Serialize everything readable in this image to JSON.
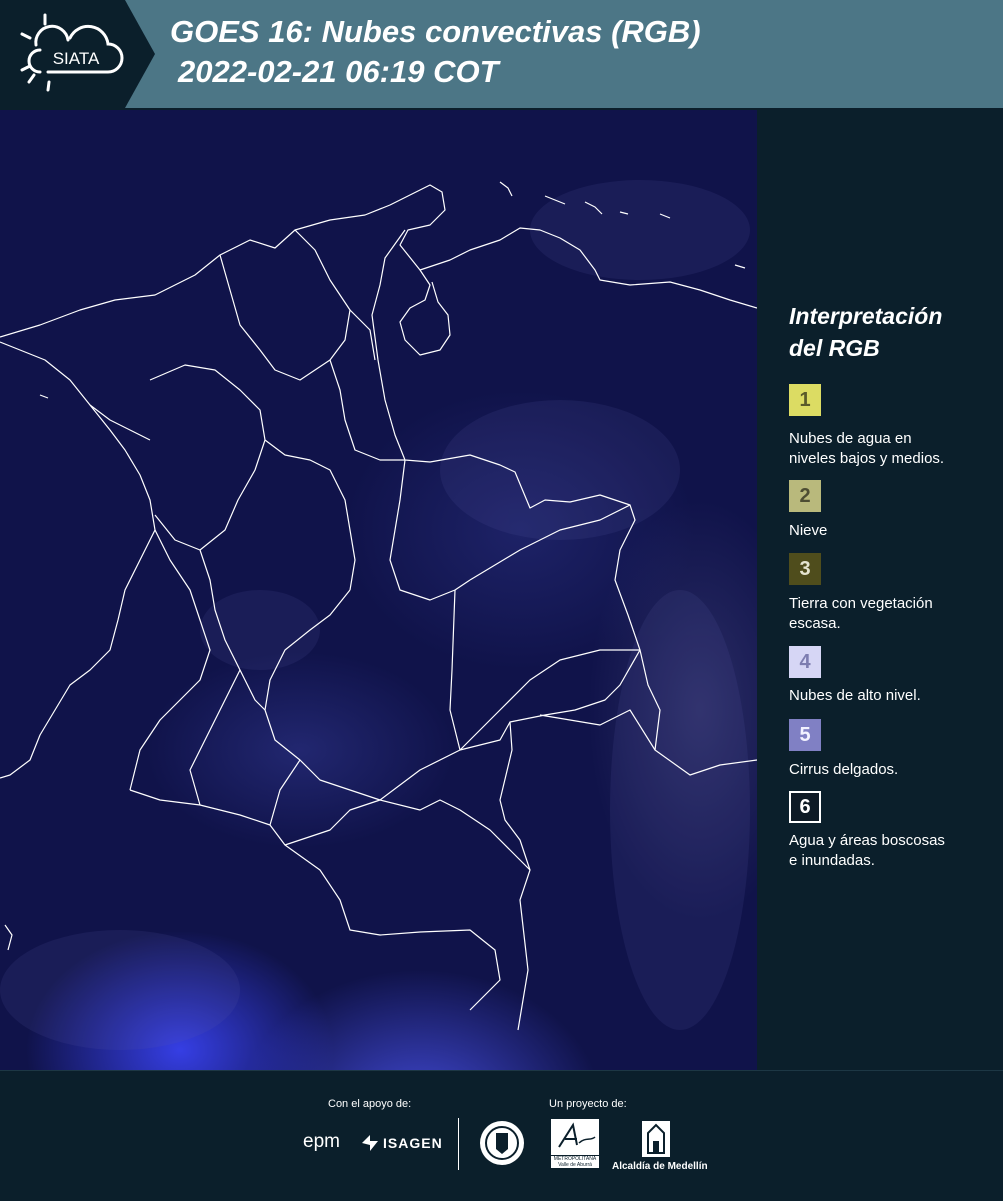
{
  "header": {
    "logo_text": "SIATA",
    "title_line1": "GOES 16: Nubes convectivas (RGB)",
    "title_line2": "2022-02-21 06:19 COT"
  },
  "legend": {
    "title_line1": "Interpretación",
    "title_line2": "del RGB",
    "items": [
      {
        "number": "1",
        "color": "#dcdc63",
        "text_color": "#5a5a2a",
        "line1": "Nubes de agua en",
        "line2": "niveles bajos y medios."
      },
      {
        "number": "2",
        "color": "#b9b97c",
        "text_color": "#4d4d33",
        "line1": "Nieve",
        "line2": ""
      },
      {
        "number": "3",
        "color": "#4f4d1c",
        "text_color": "#e5e5d0",
        "line1": "Tierra con vegetación",
        "line2": "escasa."
      },
      {
        "number": "4",
        "color": "#d6d6f5",
        "text_color": "#7d7db0",
        "line1": "Nubes de alto nivel.",
        "line2": ""
      },
      {
        "number": "5",
        "color": "#8080c4",
        "text_color": "#f2f2ff",
        "line1": "Cirrus delgados.",
        "line2": ""
      },
      {
        "number": "6",
        "color": "#0e1a25",
        "text_color": "#ffffff",
        "line1": "Agua y áreas boscosas",
        "line2": "e inundadas."
      }
    ]
  },
  "footer": {
    "support_label": "Con el apoyo de:",
    "project_label": "Un proyecto de:",
    "sponsor_epm": "epm",
    "sponsor_isagen": "ISAGEN",
    "partner_area_line1": "METROPOLITANA",
    "partner_area_line2": "Valle de Aburrá",
    "partner_alcaldia": "Alcaldía de Medellín"
  },
  "colors": {
    "header_bg": "#4c7686",
    "page_bg": "#0b1f2b",
    "map_bg": "#10134a",
    "boundary": "#ffffff"
  },
  "icons": [
    "sun-cloud-logo-icon",
    "seal-icon",
    "area-logo-icon",
    "building-icon"
  ]
}
